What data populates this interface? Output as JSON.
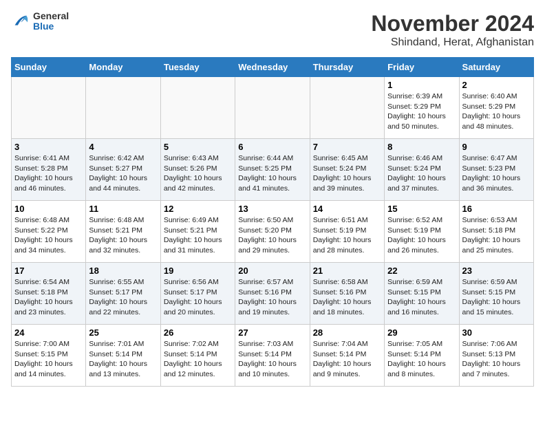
{
  "logo": {
    "general": "General",
    "blue": "Blue"
  },
  "title": "November 2024",
  "location": "Shindand, Herat, Afghanistan",
  "weekdays": [
    "Sunday",
    "Monday",
    "Tuesday",
    "Wednesday",
    "Thursday",
    "Friday",
    "Saturday"
  ],
  "rows": [
    [
      {
        "day": "",
        "info": ""
      },
      {
        "day": "",
        "info": ""
      },
      {
        "day": "",
        "info": ""
      },
      {
        "day": "",
        "info": ""
      },
      {
        "day": "",
        "info": ""
      },
      {
        "day": "1",
        "info": "Sunrise: 6:39 AM\nSunset: 5:29 PM\nDaylight: 10 hours and 50 minutes."
      },
      {
        "day": "2",
        "info": "Sunrise: 6:40 AM\nSunset: 5:29 PM\nDaylight: 10 hours and 48 minutes."
      }
    ],
    [
      {
        "day": "3",
        "info": "Sunrise: 6:41 AM\nSunset: 5:28 PM\nDaylight: 10 hours and 46 minutes."
      },
      {
        "day": "4",
        "info": "Sunrise: 6:42 AM\nSunset: 5:27 PM\nDaylight: 10 hours and 44 minutes."
      },
      {
        "day": "5",
        "info": "Sunrise: 6:43 AM\nSunset: 5:26 PM\nDaylight: 10 hours and 42 minutes."
      },
      {
        "day": "6",
        "info": "Sunrise: 6:44 AM\nSunset: 5:25 PM\nDaylight: 10 hours and 41 minutes."
      },
      {
        "day": "7",
        "info": "Sunrise: 6:45 AM\nSunset: 5:24 PM\nDaylight: 10 hours and 39 minutes."
      },
      {
        "day": "8",
        "info": "Sunrise: 6:46 AM\nSunset: 5:24 PM\nDaylight: 10 hours and 37 minutes."
      },
      {
        "day": "9",
        "info": "Sunrise: 6:47 AM\nSunset: 5:23 PM\nDaylight: 10 hours and 36 minutes."
      }
    ],
    [
      {
        "day": "10",
        "info": "Sunrise: 6:48 AM\nSunset: 5:22 PM\nDaylight: 10 hours and 34 minutes."
      },
      {
        "day": "11",
        "info": "Sunrise: 6:48 AM\nSunset: 5:21 PM\nDaylight: 10 hours and 32 minutes."
      },
      {
        "day": "12",
        "info": "Sunrise: 6:49 AM\nSunset: 5:21 PM\nDaylight: 10 hours and 31 minutes."
      },
      {
        "day": "13",
        "info": "Sunrise: 6:50 AM\nSunset: 5:20 PM\nDaylight: 10 hours and 29 minutes."
      },
      {
        "day": "14",
        "info": "Sunrise: 6:51 AM\nSunset: 5:19 PM\nDaylight: 10 hours and 28 minutes."
      },
      {
        "day": "15",
        "info": "Sunrise: 6:52 AM\nSunset: 5:19 PM\nDaylight: 10 hours and 26 minutes."
      },
      {
        "day": "16",
        "info": "Sunrise: 6:53 AM\nSunset: 5:18 PM\nDaylight: 10 hours and 25 minutes."
      }
    ],
    [
      {
        "day": "17",
        "info": "Sunrise: 6:54 AM\nSunset: 5:18 PM\nDaylight: 10 hours and 23 minutes."
      },
      {
        "day": "18",
        "info": "Sunrise: 6:55 AM\nSunset: 5:17 PM\nDaylight: 10 hours and 22 minutes."
      },
      {
        "day": "19",
        "info": "Sunrise: 6:56 AM\nSunset: 5:17 PM\nDaylight: 10 hours and 20 minutes."
      },
      {
        "day": "20",
        "info": "Sunrise: 6:57 AM\nSunset: 5:16 PM\nDaylight: 10 hours and 19 minutes."
      },
      {
        "day": "21",
        "info": "Sunrise: 6:58 AM\nSunset: 5:16 PM\nDaylight: 10 hours and 18 minutes."
      },
      {
        "day": "22",
        "info": "Sunrise: 6:59 AM\nSunset: 5:15 PM\nDaylight: 10 hours and 16 minutes."
      },
      {
        "day": "23",
        "info": "Sunrise: 6:59 AM\nSunset: 5:15 PM\nDaylight: 10 hours and 15 minutes."
      }
    ],
    [
      {
        "day": "24",
        "info": "Sunrise: 7:00 AM\nSunset: 5:15 PM\nDaylight: 10 hours and 14 minutes."
      },
      {
        "day": "25",
        "info": "Sunrise: 7:01 AM\nSunset: 5:14 PM\nDaylight: 10 hours and 13 minutes."
      },
      {
        "day": "26",
        "info": "Sunrise: 7:02 AM\nSunset: 5:14 PM\nDaylight: 10 hours and 12 minutes."
      },
      {
        "day": "27",
        "info": "Sunrise: 7:03 AM\nSunset: 5:14 PM\nDaylight: 10 hours and 10 minutes."
      },
      {
        "day": "28",
        "info": "Sunrise: 7:04 AM\nSunset: 5:14 PM\nDaylight: 10 hours and 9 minutes."
      },
      {
        "day": "29",
        "info": "Sunrise: 7:05 AM\nSunset: 5:14 PM\nDaylight: 10 hours and 8 minutes."
      },
      {
        "day": "30",
        "info": "Sunrise: 7:06 AM\nSunset: 5:13 PM\nDaylight: 10 hours and 7 minutes."
      }
    ]
  ]
}
